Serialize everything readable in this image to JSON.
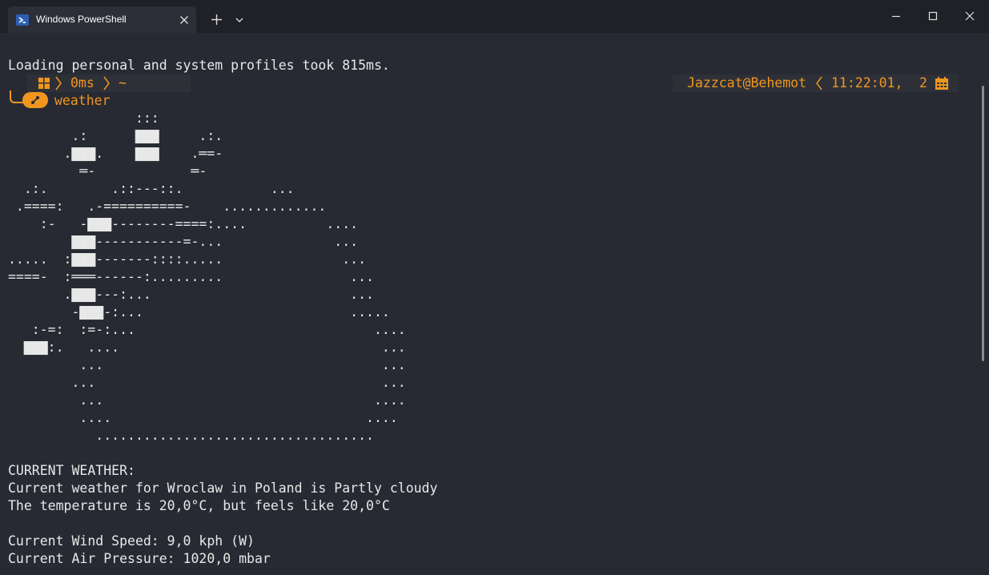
{
  "window": {
    "tab_title": "Windows PowerShell"
  },
  "prompt": {
    "duration": "0ms",
    "path": "~",
    "user_host": "Jazzcat@Behemot",
    "time": "11:22:01,",
    "day": "2",
    "command": "weather"
  },
  "output": {
    "loading": "Loading personal and system profiles took 815ms.",
    "ascii_art": "                ::: \n        .:      ▇▇▇     .:.\n       .▇▇▇.    ▇▇▇    .═=-\n         ═-            ═-\n  .:.        .::---::.           ...\n .====:   .-==========-    .............\n    :-   -▇▇▇--------====:....          ....\n        ▇▇▇-----------=-...              ...\n.....  :▇▇▇-------::::.....               ...\n====-  :═══------:.........                ...\n       .▇▇▇---:...                         ...\n        -▇▇▇-:...                          .....\n   :-=:  :=-:...                              ....\n  ▇▇▇:.   ....                                 ...\n         ...                                   ...\n        ...                                    ...\n         ...                                  ....\n         ....                                ....\n           ...................................",
    "header": "CURRENT WEATHER:",
    "summary": "Current weather for Wroclaw in Poland is Partly cloudy",
    "temperature": "The temperature is 20,0°C, but feels like 20,0°C",
    "wind": "Current Wind Speed: 9,0 kph (W)",
    "pressure": "Current Air Pressure: 1020,0 mbar"
  },
  "icons": {
    "tab": "powershell-icon",
    "close": "close-icon",
    "new_tab": "plus-icon",
    "dropdown": "chevron-down-icon",
    "minimize": "minimize-icon",
    "maximize": "maximize-icon",
    "window_close": "close-icon",
    "os": "windows-icon",
    "git": "git-icon",
    "calendar": "calendar-icon"
  },
  "colors": {
    "accent": "#f0961e",
    "background": "#272a33",
    "text": "#e8e8e8"
  }
}
